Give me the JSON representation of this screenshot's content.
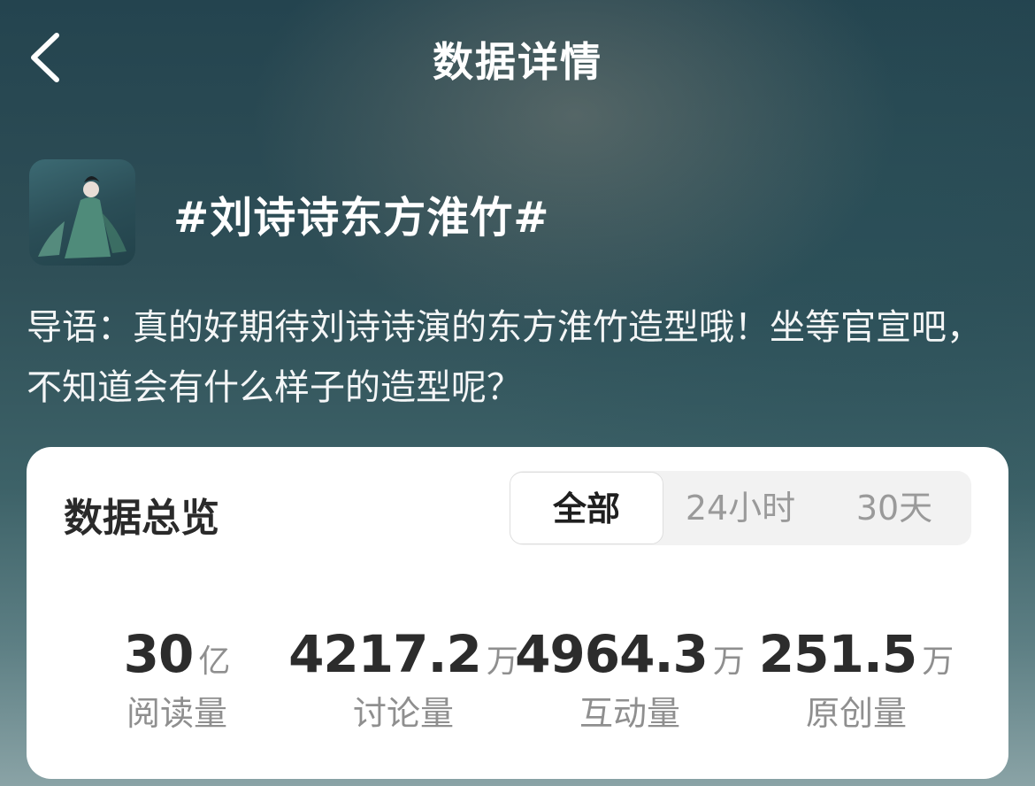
{
  "header": {
    "title": "数据详情"
  },
  "topic": {
    "name": "#刘诗诗东方淮竹#"
  },
  "intro": {
    "text": "导语：真的好期待刘诗诗演的东方淮竹造型哦！坐等官宣吧，不知道会有什么样子的造型呢？"
  },
  "overview": {
    "title": "数据总览",
    "tabs": [
      {
        "label": "全部",
        "active": true
      },
      {
        "label": "24小时",
        "active": false
      },
      {
        "label": "30天",
        "active": false
      }
    ],
    "stats": [
      {
        "value": "30",
        "unit": "亿",
        "label": "阅读量"
      },
      {
        "value": "4217.2",
        "unit": "万",
        "label": "讨论量"
      },
      {
        "value": "4964.3",
        "unit": "万",
        "label": "互动量"
      },
      {
        "value": "251.5",
        "unit": "万",
        "label": "原创量"
      }
    ]
  },
  "colors": {
    "card_bg": "#ffffff",
    "primary_text": "#2c2c2c",
    "secondary_text": "#8f8f8f"
  },
  "icons": {
    "back": "chevron-left-icon"
  }
}
